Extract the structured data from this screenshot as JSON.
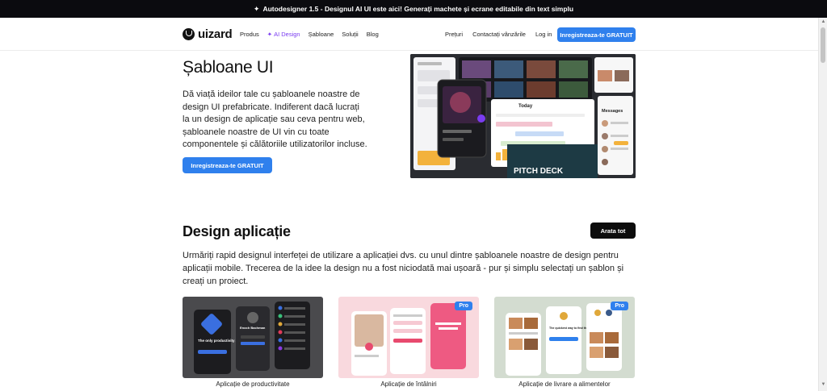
{
  "announcement": {
    "text": "Autodesigner 1.5 - Designul AI UI este aici! Generați machete și ecrane editabile din text simplu",
    "icon": "sparkle-icon"
  },
  "header": {
    "logo_text": "uizard",
    "nav_left": [
      "Produs",
      "AI Design",
      "Șabloane",
      "Soluții",
      "Blog"
    ],
    "nav_right": [
      "Prețuri",
      "Contactați vânzările",
      "Log in"
    ],
    "cta": "Inregistreaza-te GRATUIT"
  },
  "hero": {
    "title": "Șabloane UI",
    "description": "Dă viață ideilor tale cu șabloanele noastre de design UI prefabricate. Indiferent dacă lucrați la un design de aplicație sau ceva pentru web, șabloanele noastre de UI vin cu toate componentele și călătoriile utilizatorilor incluse.",
    "cta": "Inregistreaza-te GRATUIT",
    "preview_texts": {
      "today": "Today",
      "pitch": "PITCH DECK",
      "messages": "Messages"
    }
  },
  "section": {
    "title": "Design aplicație",
    "button": "Arata tot",
    "description": "Urmăriți rapid designul interfeței de utilizare a aplicației dvs. cu unul dintre șabloanele noastre de design pentru aplicații mobile. Trecerea de la idee la design nu a fost niciodată mai ușoară - pur și simplu selectați un șablon și creați un proiect."
  },
  "cards": [
    {
      "label": "Aplicație de productivitate",
      "pro": "",
      "preview_texts": [
        "The only productivity app you need",
        "Enoch Bachman"
      ]
    },
    {
      "label": "Aplicație de întâlniri",
      "pro": "Pro",
      "preview_texts": []
    },
    {
      "label": "Aplicație de livrare a alimentelor",
      "pro": "Pro",
      "preview_texts": [
        "The quickest way to find the perfect bite"
      ]
    }
  ],
  "colors": {
    "accent": "#2f80ed",
    "ai": "#7a3cf0",
    "dark": "#0b0b0f"
  }
}
